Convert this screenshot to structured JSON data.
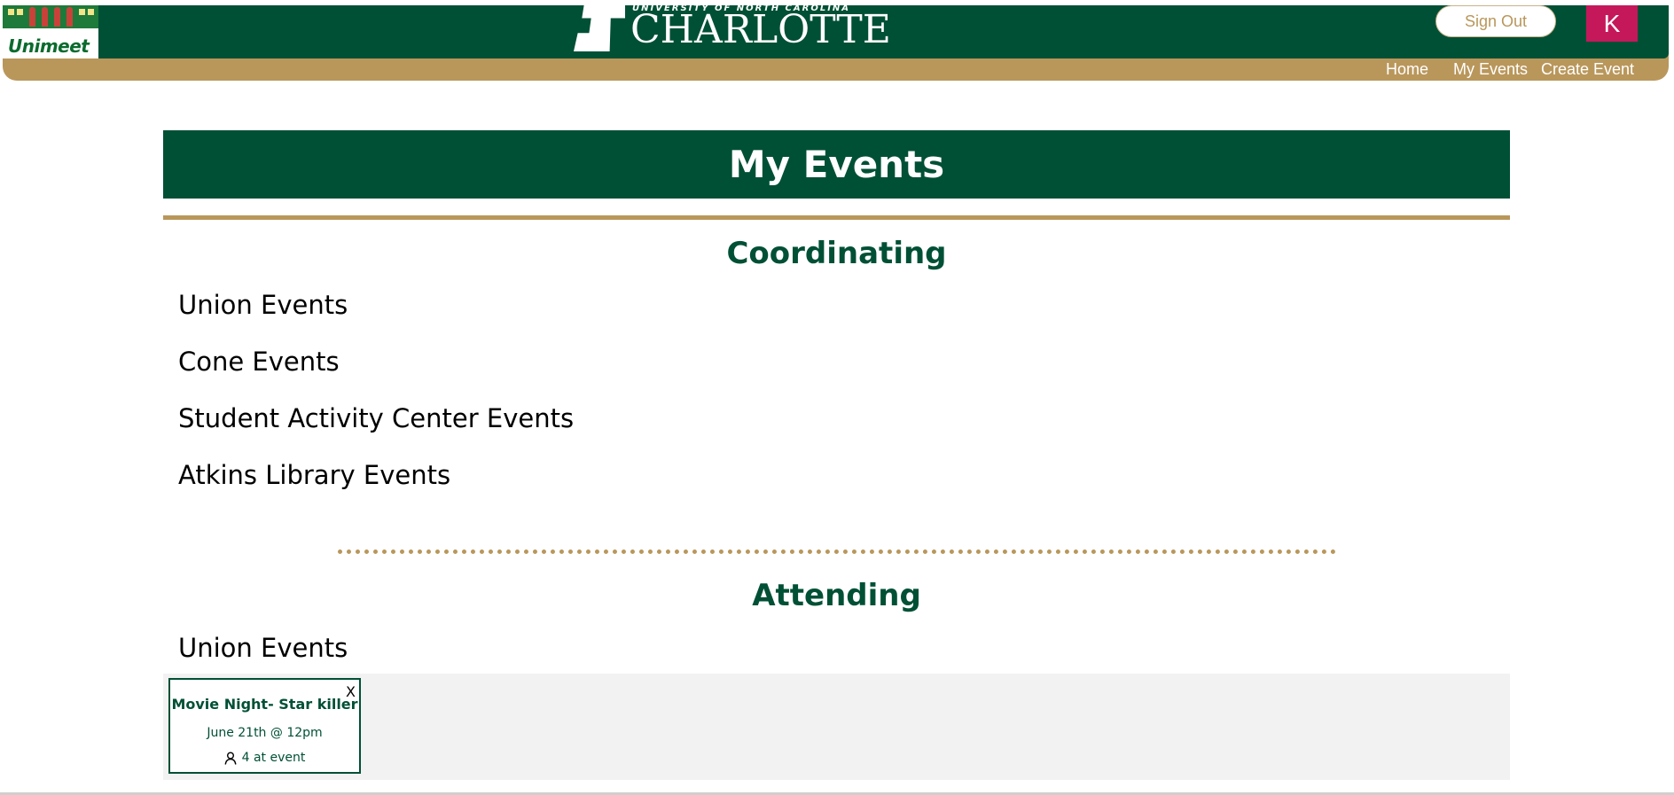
{
  "header": {
    "logo_text": "Unimeet",
    "university_small": "UNIVERSITY OF NORTH CAROLINA",
    "university_big": "CHARLOTTE",
    "sign_out_label": "Sign Out",
    "avatar_initial": "K",
    "nav": {
      "home": "Home",
      "my_events": "My Events",
      "create_event": "Create Event"
    }
  },
  "colors": {
    "primary_green": "#005035",
    "gold": "#b9975b",
    "avatar_bg": "#c5185b",
    "card_area_bg": "#f2f2f2"
  },
  "page": {
    "title": "My Events",
    "coordinating": {
      "title": "Coordinating",
      "venues": [
        "Union Events",
        "Cone Events",
        "Student Activity Center Events",
        "Atkins Library Events"
      ]
    },
    "attending": {
      "title": "Attending",
      "venue": "Union Events",
      "events": [
        {
          "name": "Movie Night- Star killer",
          "date": "June 21th @ 12pm",
          "attendance": "4 at event",
          "close_label": "X"
        }
      ]
    }
  }
}
